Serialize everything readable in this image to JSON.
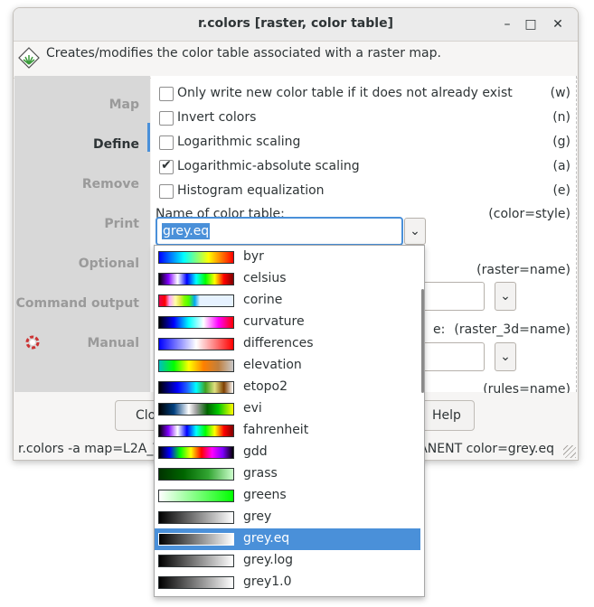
{
  "window": {
    "title": "r.colors [raster, color table]",
    "description": "Creates/modifies the color table associated with a raster map."
  },
  "sidebar": {
    "items": [
      {
        "label": "Map"
      },
      {
        "label": "Define"
      },
      {
        "label": "Remove"
      },
      {
        "label": "Print"
      },
      {
        "label": "Optional"
      },
      {
        "label": "Command output"
      },
      {
        "label": "Manual"
      }
    ],
    "active": "Define"
  },
  "checkboxes": [
    {
      "label": "Only write new color table if it does not already exist",
      "flag": "(w)",
      "checked": false
    },
    {
      "label": "Invert colors",
      "flag": "(n)",
      "checked": false
    },
    {
      "label": "Logarithmic scaling",
      "flag": "(g)",
      "checked": false
    },
    {
      "label": "Logarithmic-absolute scaling",
      "flag": "(a)",
      "checked": true
    },
    {
      "label": "Histogram equalization",
      "flag": "(e)",
      "checked": false
    }
  ],
  "color_param": {
    "label": "Name of color table:",
    "flag": "(color=style)",
    "value": "grey.eq"
  },
  "partial": {
    "raster_flag": "(raster=name)",
    "raster3d_text": "e:",
    "raster3d_flag": "(raster_3d=name)",
    "rules_flag": "(rules=name)",
    "close_fragment": "Clo",
    "help_fragment": "Help",
    "check_mark": "✔",
    "chevron": "⌄"
  },
  "buttons": {
    "close": "Clo",
    "help": "Help"
  },
  "statusbar": {
    "left": "r.colors -a map=L2A_T",
    "right": "ANENT color=grey.eq"
  },
  "dropdown": {
    "items": [
      {
        "name": "byr",
        "gradient": "linear-gradient(to right,#0000ff,#00ffff,#ffff00,#ff0000)"
      },
      {
        "name": "celsius",
        "gradient": "linear-gradient(to right,#000000,#7f00ff,#ffffff,#0000ff,#00ffff,#00ff00,#ffff00,#ff0000,#7f0000)"
      },
      {
        "name": "corine",
        "gradient": "linear-gradient(to right,#e6004d 0%,#ff0000 8%,#ffa6ff 14%,#ffffa8 22%,#e6e64d 28%,#80ff00 34%,#4dff00 40%,#00a6f2 48%,#e6f2ff 55%,#e6f2ff 100%)"
      },
      {
        "name": "curvature",
        "gradient": "linear-gradient(to right,#000000,#0000ff,#00ffff,#ffffff,#ff00ff,#ff0000)"
      },
      {
        "name": "differences",
        "gradient": "linear-gradient(to right,#0000ff,#ffffff,#ff0000)"
      },
      {
        "name": "elevation",
        "gradient": "linear-gradient(to right,#00bfbf,#00ff00,#ffff00,#ff7f00,#bf7f3f,#c8c8c8)"
      },
      {
        "name": "etopo2",
        "gradient": "linear-gradient(to right,#000000,#00007f,#0000ff,#2060ff,#00ffff,#40a020,#e0e080,#7f3f00,#ffffff)"
      },
      {
        "name": "evi",
        "gradient": "linear-gradient(to right,#000000 0%,#003f7f 20%,#ffffff 40%,#a0a0a0 50%,#006400 65%,#00c800 80%,#ffff00 100%)"
      },
      {
        "name": "fahrenheit",
        "gradient": "linear-gradient(to right,#000000,#7f00ff,#ffffff,#0000ff,#00ffff,#00ff00,#ffff00,#ff0000,#7f0000)"
      },
      {
        "name": "gdd",
        "gradient": "linear-gradient(to right,#000000,#0000ff,#00ff00,#ffff00,#ff0000,#ff00ff,#7f00ff,#000000)"
      },
      {
        "name": "grass",
        "gradient": "linear-gradient(to right,#003300,#006600,#33a633,#ccffcc)"
      },
      {
        "name": "greens",
        "gradient": "linear-gradient(to right,#ffffff,#00ff00)"
      },
      {
        "name": "grey",
        "gradient": "linear-gradient(to right,#000000,#ffffff)"
      },
      {
        "name": "grey.eq",
        "gradient": "linear-gradient(to right,#000000,#ffffff)"
      },
      {
        "name": "grey.log",
        "gradient": "linear-gradient(to right,#000000,#ffffff)"
      },
      {
        "name": "grey1.0",
        "gradient": "linear-gradient(to right,#000000,#ffffff)"
      }
    ],
    "selected": "grey.eq"
  },
  "colors": {
    "accent": "#4a90d9",
    "sidebar_bg": "#d8d8d8",
    "window_bg": "#f6f5f4"
  }
}
